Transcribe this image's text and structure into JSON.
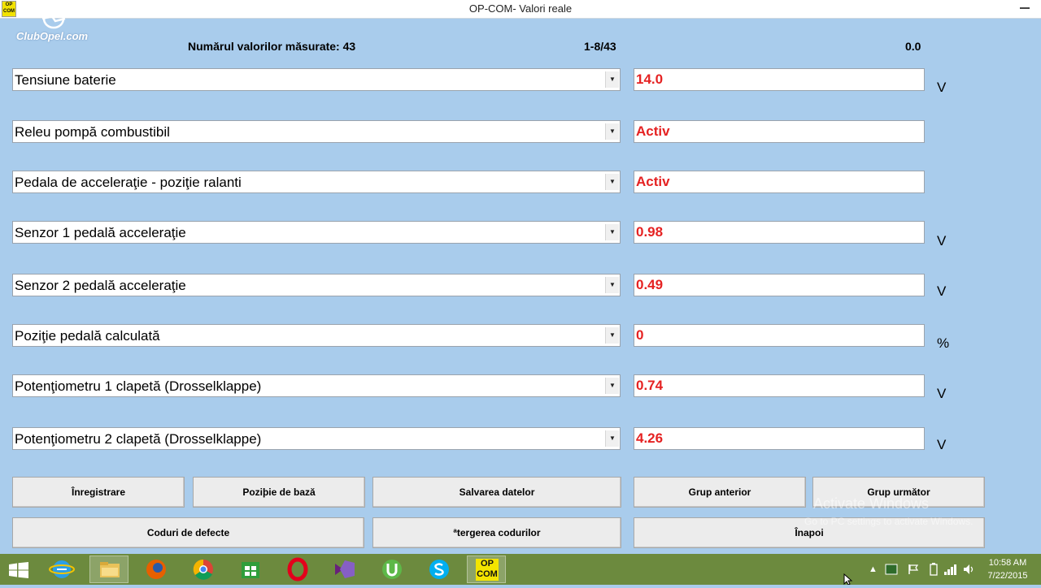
{
  "window": {
    "title": "OP-COM- Valori reale",
    "app_icon_text": [
      "OP",
      "COM"
    ],
    "logo_text": "ClubOpel.com"
  },
  "header": {
    "measured_label": "Numărul valorilor măsurate: 43",
    "range": "1-8/43",
    "time_value": "0.0"
  },
  "rows": [
    {
      "label": "Tensiune baterie",
      "value": "14.0",
      "unit": "V"
    },
    {
      "label": "Releu pompă combustibil",
      "value": "Activ",
      "unit": ""
    },
    {
      "label": "Pedala de acceleraţie - poziţie ralanti",
      "value": "Activ",
      "unit": ""
    },
    {
      "label": "Senzor 1 pedală acceleraţie",
      "value": "0.98",
      "unit": "V"
    },
    {
      "label": "Senzor 2 pedală acceleraţie",
      "value": "0.49",
      "unit": "V"
    },
    {
      "label": "Poziţie pedală calculată",
      "value": "0",
      "unit": "%"
    },
    {
      "label": "Potenţiometru 1 clapetă (Drosselklappe)",
      "value": "0.74",
      "unit": "V"
    },
    {
      "label": "Potenţiometru 2 clapetă (Drosselklappe)",
      "value": "4.26",
      "unit": "V"
    }
  ],
  "buttons": {
    "record": "Înregistrare",
    "base_position": "Poziþie de bază",
    "save_data": "Salvarea datelor",
    "prev_group": "Grup anterior",
    "next_group": "Grup următor",
    "fault_codes": "Coduri de defecte",
    "clear_codes": "ªtergerea codurilor",
    "back": "Înapoi"
  },
  "watermark": {
    "line1": "Activate Windows",
    "line2": "Go to PC settings to activate Windows."
  },
  "taskbar": {
    "opcom_text": [
      "OP",
      "COM"
    ],
    "time": "10:58 AM",
    "date": "7/22/2015"
  },
  "colors": {
    "background": "#a9ccec",
    "value_text": "#e52222",
    "taskbar": "#6c8a3e"
  }
}
